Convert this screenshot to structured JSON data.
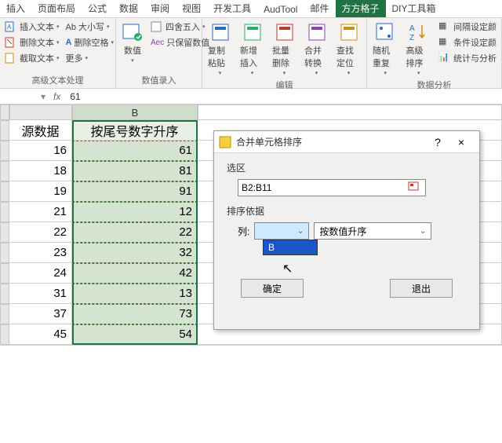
{
  "tabs": [
    "插入",
    "页面布局",
    "公式",
    "数据",
    "审阅",
    "视图",
    "开发工具",
    "AudTool",
    "邮件",
    "方方格子",
    "DIY工具箱"
  ],
  "active_tab_index": 9,
  "ribbon": {
    "g1": {
      "items": [
        "插入文本",
        "删除文本",
        "截取文本"
      ],
      "items2": [
        "Ab 大小写",
        "删除空格",
        "更多"
      ],
      "label": "高级文本处理"
    },
    "g2": {
      "big": "数值",
      "items": [
        "四舍五入",
        "只保留数值"
      ],
      "label": "数值录入"
    },
    "g3": {
      "items": [
        "复制粘贴",
        "新增插入",
        "批量删除",
        "合并转换",
        "查找定位"
      ]
    },
    "g4": {
      "items": [
        "随机重复",
        "高级排序"
      ],
      "extras": [
        "间隔设定颜",
        "条件设定颜",
        "统计与分析"
      ],
      "label": "数据分析"
    }
  },
  "formula_bar": {
    "ref": "",
    "fx": "fx",
    "value": "61"
  },
  "columns": [
    "",
    "B"
  ],
  "headers": {
    "a": "源数据",
    "b": "按尾号数字升序"
  },
  "chart_data": {
    "type": "table",
    "columns": [
      "源数据",
      "按尾号数字升序"
    ],
    "rows": [
      [
        16,
        61
      ],
      [
        18,
        81
      ],
      [
        19,
        91
      ],
      [
        21,
        12
      ],
      [
        22,
        22
      ],
      [
        23,
        32
      ],
      [
        24,
        42
      ],
      [
        31,
        13
      ],
      [
        37,
        73
      ],
      [
        45,
        54
      ]
    ]
  },
  "dialog": {
    "title": "合并单元格排序",
    "section1": "选区",
    "range": "B2:B11",
    "section2": "排序依据",
    "col_label": "列:",
    "col_options": [
      "B"
    ],
    "col_value": "",
    "sort_type": "按数值升序",
    "ok": "确定",
    "cancel": "退出",
    "help": "?",
    "close": "×"
  }
}
